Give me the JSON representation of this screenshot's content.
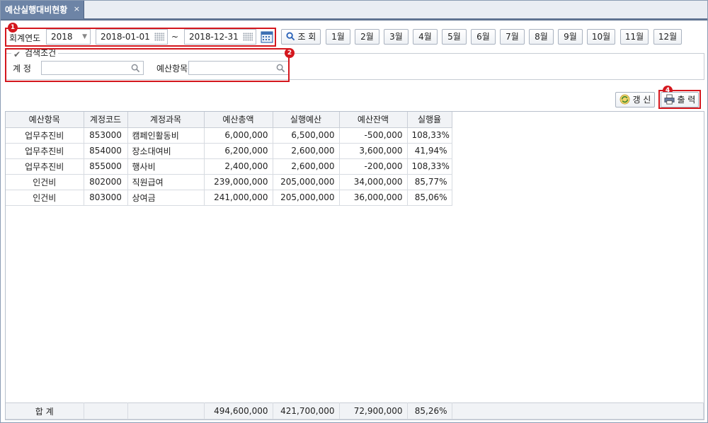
{
  "tab": {
    "title": "예산실행대비현황",
    "close": "×"
  },
  "filters": {
    "year_label": "회계연도",
    "year_value": "2018",
    "date_from": "2018-01-01",
    "date_sep": "~",
    "date_to": "2018-12-31",
    "search_label": "조 회",
    "months": [
      "1월",
      "2월",
      "3월",
      "4월",
      "5월",
      "6월",
      "7월",
      "8월",
      "9월",
      "10월",
      "11월",
      "12월"
    ]
  },
  "conditions": {
    "legend": "검색조건",
    "account_label": "계 정",
    "account_value": "",
    "budget_item_label": "예산항목",
    "budget_item_value": ""
  },
  "actions": {
    "refresh_label": "갱 신",
    "print_label": "출 력"
  },
  "badges": {
    "b1": "1",
    "b2": "2",
    "b4": "4"
  },
  "table": {
    "headers": [
      "예산항목",
      "계정코드",
      "계정과목",
      "예산총액",
      "실행예산",
      "예산잔액",
      "실행율"
    ],
    "rows": [
      [
        "업무추진비",
        "853000",
        "캠페인활동비",
        "6,000,000",
        "6,500,000",
        "-500,000",
        "108,33%"
      ],
      [
        "업무추진비",
        "854000",
        "장소대여비",
        "6,200,000",
        "2,600,000",
        "3,600,000",
        "41,94%"
      ],
      [
        "업무추진비",
        "855000",
        "행사비",
        "2,400,000",
        "2,600,000",
        "-200,000",
        "108,33%"
      ],
      [
        "인건비",
        "802000",
        "직원급여",
        "239,000,000",
        "205,000,000",
        "34,000,000",
        "85,77%"
      ],
      [
        "인건비",
        "803000",
        "상여금",
        "241,000,000",
        "205,000,000",
        "36,000,000",
        "85,06%"
      ]
    ],
    "total": [
      "합 계",
      "",
      "",
      "494,600,000",
      "421,700,000",
      "72,900,000",
      "85,26%"
    ]
  },
  "colors": {
    "highlight": "#d4171e",
    "tab": "#6d84a6"
  }
}
